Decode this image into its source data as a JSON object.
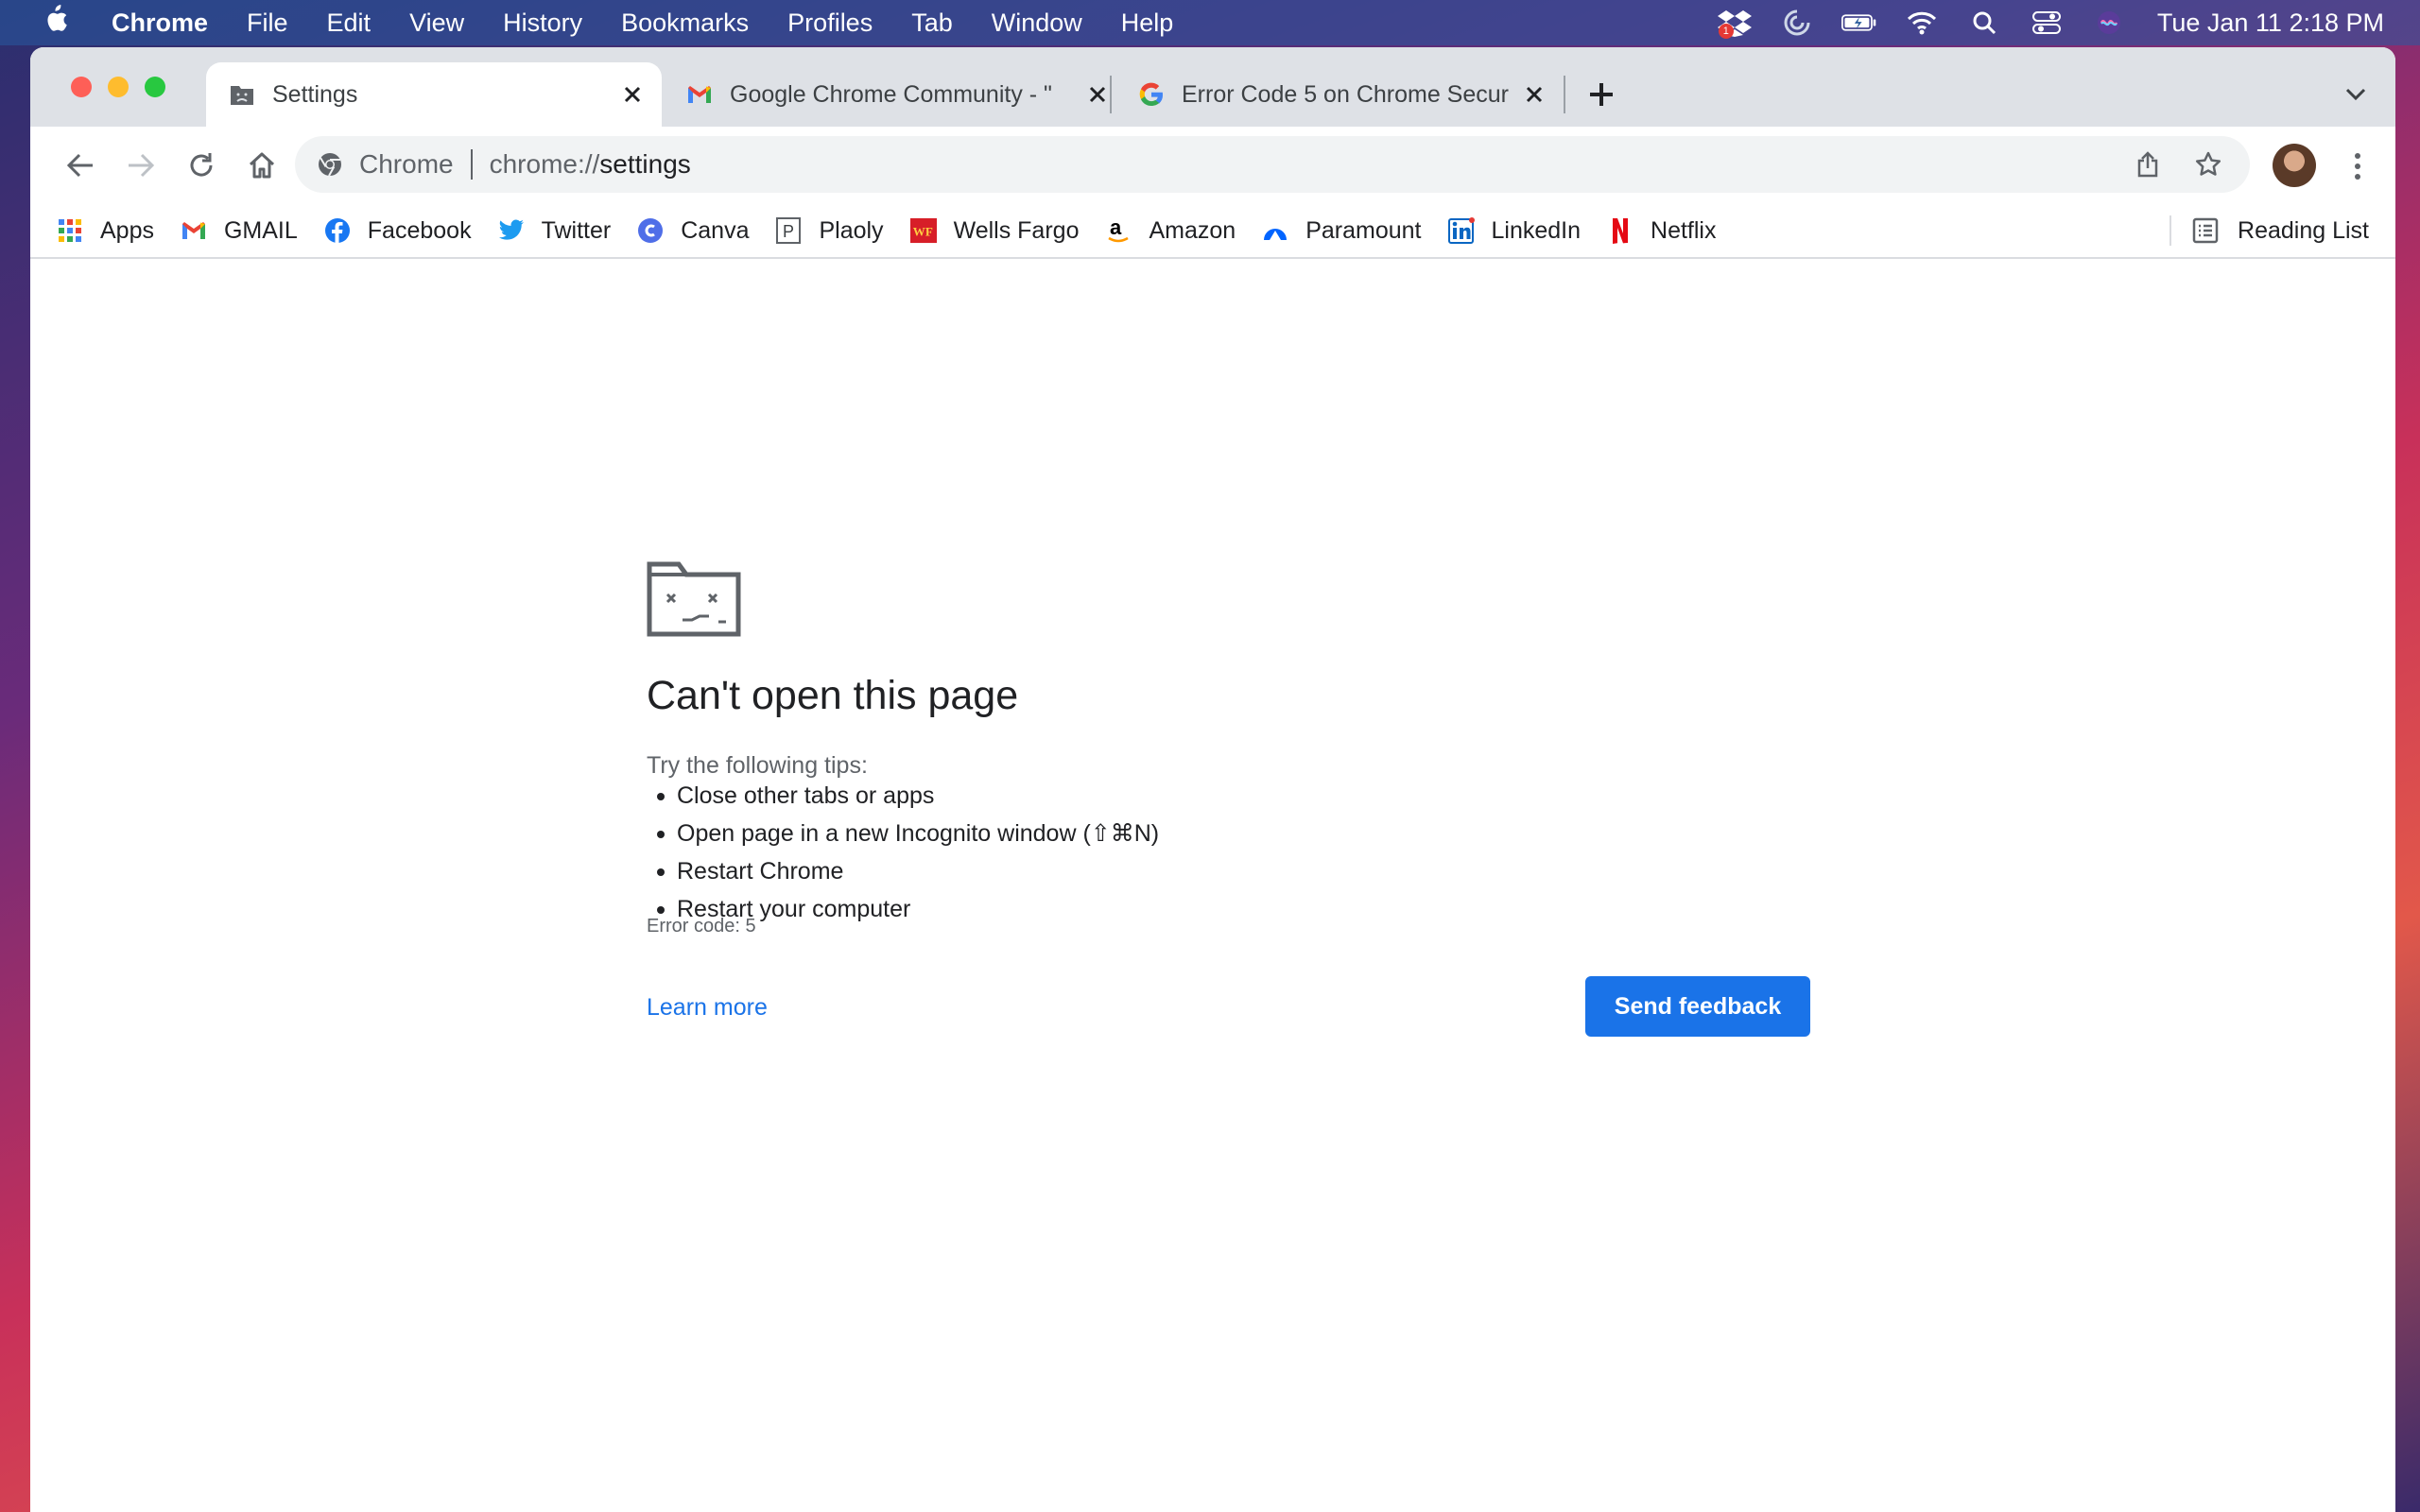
{
  "menubar": {
    "app": "Chrome",
    "items": [
      "File",
      "Edit",
      "View",
      "History",
      "Bookmarks",
      "Profiles",
      "Tab",
      "Window",
      "Help"
    ],
    "dropbox_badge": "1",
    "clock": "Tue Jan 11  2:18 PM"
  },
  "tabs": [
    {
      "title": "Settings",
      "icon": "settings-page-icon",
      "active": true
    },
    {
      "title": "Google Chrome Community - \"",
      "icon": "gmail-icon",
      "active": false
    },
    {
      "title": "Error Code 5 on Chrome Secur",
      "icon": "google-icon",
      "active": false
    }
  ],
  "omnibox": {
    "chip": "Chrome",
    "url_scheme": "chrome://",
    "url_host": "settings"
  },
  "bookmarks": [
    {
      "label": "Apps",
      "icon": "apps-grid-icon"
    },
    {
      "label": "GMAIL",
      "icon": "gmail-icon"
    },
    {
      "label": "Facebook",
      "icon": "facebook-icon"
    },
    {
      "label": "Twitter",
      "icon": "twitter-icon"
    },
    {
      "label": "Canva",
      "icon": "canva-icon"
    },
    {
      "label": "Plaoly",
      "icon": "plaoly-icon"
    },
    {
      "label": "Wells Fargo",
      "icon": "wells-fargo-icon"
    },
    {
      "label": "Amazon",
      "icon": "amazon-icon"
    },
    {
      "label": "Paramount",
      "icon": "paramount-icon"
    },
    {
      "label": "LinkedIn",
      "icon": "linkedin-icon"
    },
    {
      "label": "Netflix",
      "icon": "netflix-icon"
    }
  ],
  "reading_list": "Reading List",
  "error_page": {
    "title": "Can't open this page",
    "tips_title": "Try the following tips:",
    "tips": [
      "Close other tabs or apps",
      "Open page in a new Incognito window (⇧⌘N)",
      "Restart Chrome",
      "Restart your computer"
    ],
    "error_code": "Error code: 5",
    "learn_more": "Learn more",
    "send_feedback": "Send feedback"
  },
  "colors": {
    "accent": "#1a73e8",
    "tabstrip": "#dee1e6",
    "omnibox": "#f1f3f4"
  }
}
